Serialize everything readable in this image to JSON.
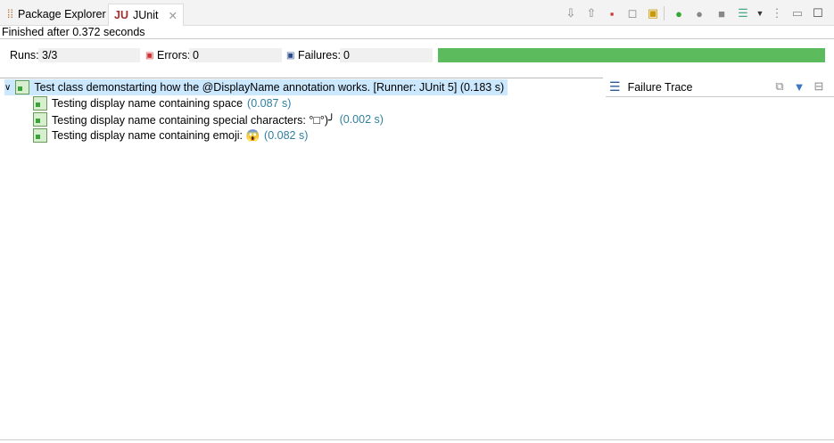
{
  "tabs": [
    {
      "label": "Package Explorer"
    },
    {
      "label": "JUnit"
    }
  ],
  "status": "Finished after 0.372 seconds",
  "counters": {
    "runs_label": "Runs:",
    "runs": "3/3",
    "errors_label": "Errors:",
    "errors": "0",
    "failures_label": "Failures:",
    "failures": "0"
  },
  "progress": 1.0,
  "colors": {
    "progress": "#5cbb5c",
    "time": "#2f7f9f",
    "selection": "#cce8ff"
  },
  "tree": {
    "root": {
      "label": "Test class demonstarting how the @DisplayName annotation works. [Runner: JUnit 5] (0.183 s)"
    },
    "children": [
      {
        "label": "Testing display name containing space",
        "time": "(0.087 s)"
      },
      {
        "label": "Testing display name containing special characters: °□°)╯",
        "time": "(0.002 s)"
      },
      {
        "label": "Testing display name containing emoji: 😱",
        "time": "(0.082 s)"
      }
    ]
  },
  "failure_trace": {
    "title": "Failure Trace"
  }
}
